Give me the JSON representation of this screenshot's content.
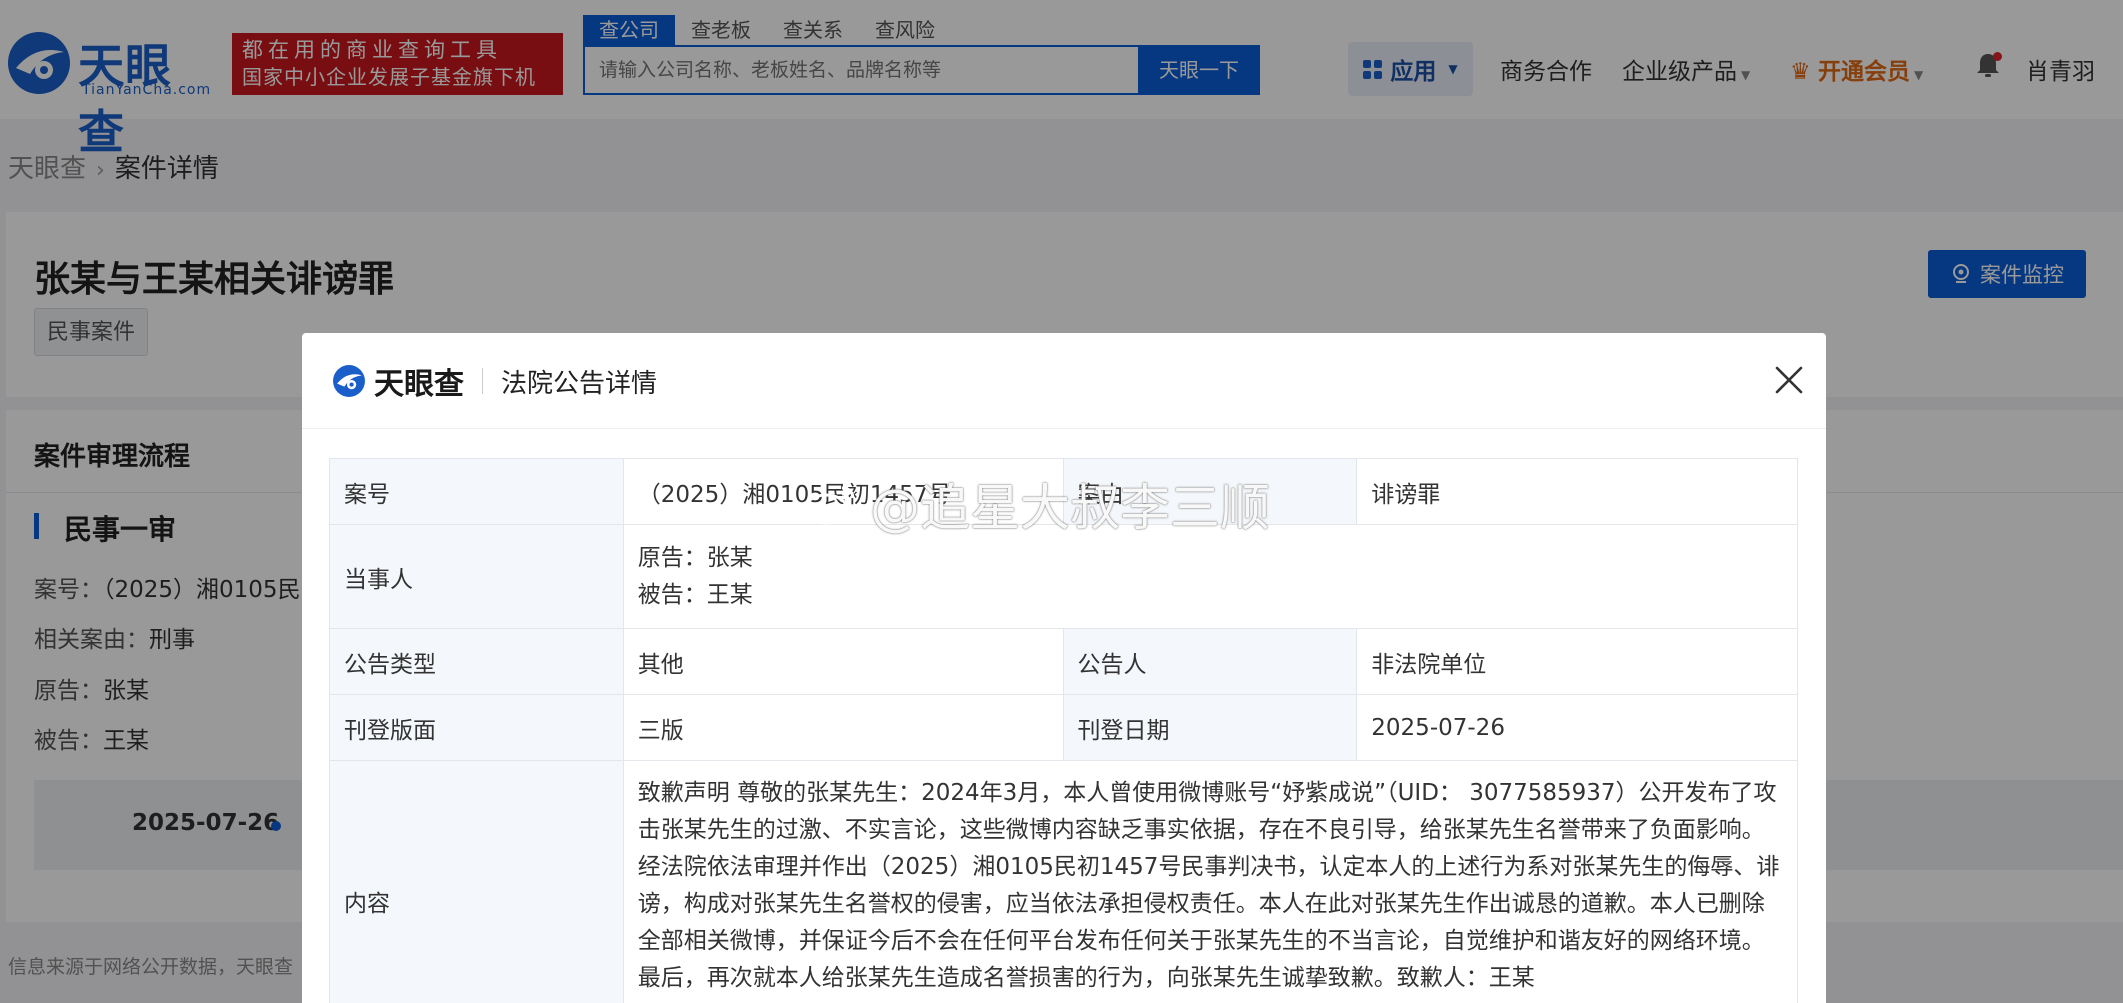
{
  "header": {
    "logo_text": "天眼查",
    "logo_subtext": "TianYanCha.com",
    "slogan_line1": "都在用的商业查询工具",
    "slogan_line2": "国家中小企业发展子基金旗下机构",
    "search_tabs": [
      "查公司",
      "查老板",
      "查关系",
      "查风险"
    ],
    "search_placeholder": "请输入公司名称、老板姓名、品牌名称等",
    "search_button": "天眼一下",
    "nav": {
      "apps": "应用",
      "business": "商务合作",
      "enterprise": "企业级产品",
      "vip": "开通会员",
      "user": "肖青羽"
    }
  },
  "breadcrumb": {
    "home": "天眼查",
    "current": "案件详情"
  },
  "case": {
    "title": "张某与王某相关诽谤罪",
    "tag": "民事案件",
    "monitor_button": "案件监控"
  },
  "process": {
    "title": "案件审理流程",
    "stage_title": "民事一审",
    "case_no_label": "案号：",
    "case_no_value": "（2025）湘0105民",
    "related_label": "相关案由：",
    "related_value": "刑事",
    "plaintiff_label": "原告：",
    "plaintiff_value": "张某",
    "defendant_label": "被告：",
    "defendant_value": "王某",
    "timeline_date": "2025-07-26"
  },
  "footer_source": "信息来源于网络公开数据，天眼查",
  "modal": {
    "logo_text": "天眼查",
    "title": "法院公告详情",
    "rows": {
      "case_no_label": "案号",
      "case_no_value": "（2025）湘0105民初1457号",
      "cause_label": "案由",
      "cause_value": "诽谤罪",
      "parties_label": "当事人",
      "plaintiff": "原告：张某",
      "defendant": "被告：王某",
      "type_label": "公告类型",
      "type_value": "其他",
      "announcer_label": "公告人",
      "announcer_value": "非法院单位",
      "page_label": "刊登版面",
      "page_value": "三版",
      "date_label": "刊登日期",
      "date_value": "2025-07-26",
      "content_label": "内容",
      "content_value": "致歉声明 尊敬的张某先生：2024年3月，本人曾使用微博账号“妤紫成说”（UID： 3077585937）公开发布了攻击张某先生的过激、不实言论，这些微博内容缺乏事实依据，存在不良引导，给张某先生名誉带来了负面影响。经法院依法审理并作出（2025）湘0105民初1457号民事判决书，认定本人的上述行为系对张某先生的侮辱、诽谤，构成对张某先生名誉权的侵害，应当依法承担侵权责任。本人在此对张某先生作出诚恳的道歉。本人已删除全部相关微博，并保证今后不会在任何平台发布任何关于张某先生的不当言论，自觉维护和谐友好的网络环境。最后，再次就本人给张某先生造成名誉损害的行为，向张某先生诚挚致歉。致歉人：王某"
    }
  },
  "watermark": "@追星大叔李三顺",
  "colors": {
    "brand_blue": "#0b5ed8",
    "slogan_red": "#c8181e",
    "vip_orange": "#e06a14"
  }
}
